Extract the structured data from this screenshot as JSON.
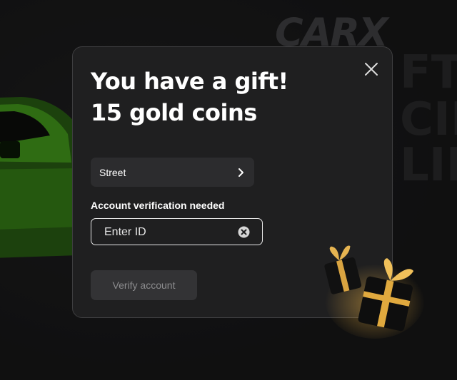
{
  "background": {
    "logo_text": "CARX",
    "big_letters": [
      "FT",
      "CIN",
      "LIN"
    ]
  },
  "modal": {
    "title_line1": "You have a gift!",
    "title_line2": "15 gold coins",
    "server_select": {
      "value": "Street"
    },
    "verification_label": "Account verification needed",
    "id_input": {
      "placeholder": "Enter ID",
      "value": ""
    },
    "verify_button": "Verify account"
  },
  "colors": {
    "modal_bg": "#1f1f20",
    "accent_gold": "#d9a441",
    "car_green": "#4caf1f"
  },
  "icons": {
    "close": "close-icon",
    "chevron": "chevron-right-icon",
    "clear": "clear-circle-icon",
    "gift": "gift-boxes-illustration"
  }
}
